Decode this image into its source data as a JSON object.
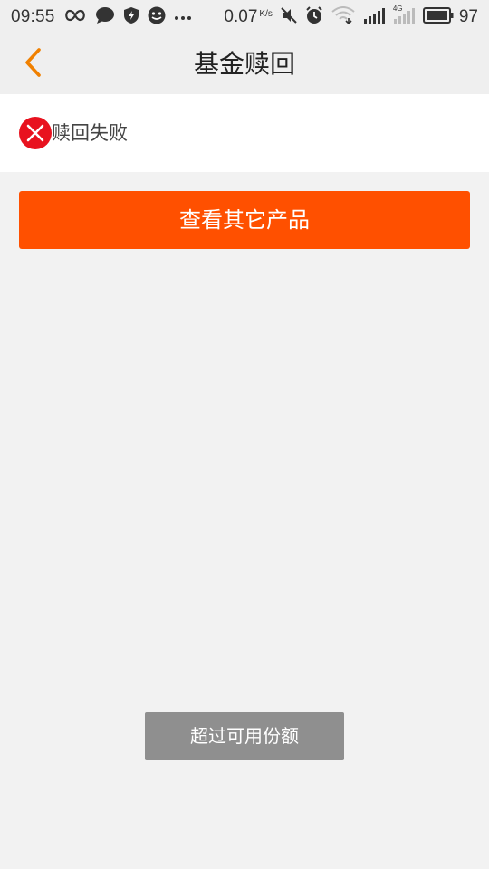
{
  "status_bar": {
    "time": "09:55",
    "net_speed": "0.07",
    "net_speed_unit": "K/s",
    "network_label": "4G",
    "battery": "97",
    "icons": [
      "infinity-icon",
      "chat-bubble-icon",
      "shield-icon",
      "face-icon",
      "more-dots-icon",
      "mute-icon",
      "alarm-icon",
      "wifi-icon",
      "signal-icon",
      "signal-4g-icon",
      "battery-icon"
    ]
  },
  "header": {
    "title": "基金赎回",
    "back_icon": "chevron-left-icon"
  },
  "result": {
    "icon": "error-x-icon",
    "message": "赎回失败"
  },
  "actions": {
    "primary_label": "查看其它产品"
  },
  "toast": {
    "message": "超过可用份额"
  },
  "colors": {
    "accent": "#ff5000",
    "back_arrow": "#f08000",
    "error_red": "#e8121f",
    "toast_bg": "#8f8f8f",
    "page_bg": "#f2f2f2"
  }
}
